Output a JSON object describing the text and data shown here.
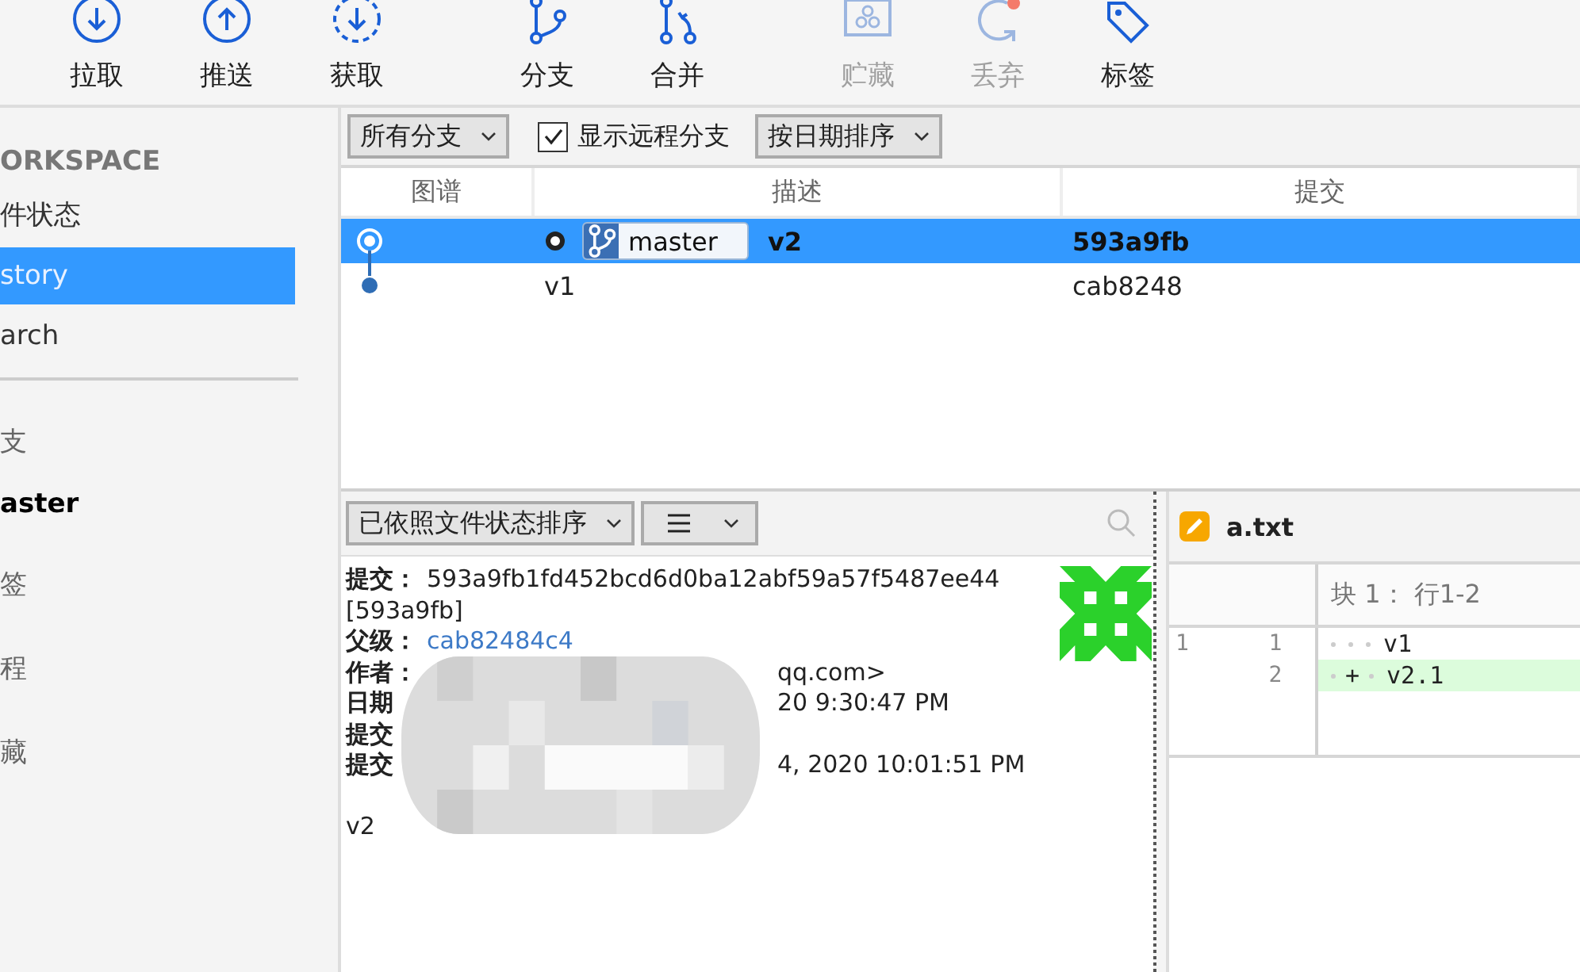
{
  "toolbar": [
    {
      "label": "拉取",
      "kind": "pull",
      "disabled": false
    },
    {
      "label": "推送",
      "kind": "push",
      "disabled": false
    },
    {
      "label": "获取",
      "kind": "fetch",
      "disabled": false
    },
    {
      "label": "分支",
      "kind": "branch",
      "disabled": false
    },
    {
      "label": "合并",
      "kind": "merge",
      "disabled": false
    },
    {
      "label": "贮藏",
      "kind": "stash",
      "disabled": true
    },
    {
      "label": "丢弃",
      "kind": "discard",
      "disabled": true
    },
    {
      "label": "标签",
      "kind": "tag",
      "disabled": false
    }
  ],
  "sidebar": {
    "workspace": {
      "title": "ORKSPACE",
      "items": [
        {
          "label": "件状态",
          "selected": false
        },
        {
          "label": "story",
          "selected": true
        },
        {
          "label": "arch",
          "selected": false
        }
      ]
    },
    "sections": [
      {
        "title": "支",
        "items": [
          {
            "label": "aster",
            "current": true
          }
        ]
      },
      {
        "title": "签"
      },
      {
        "title": "程"
      },
      {
        "title": "藏"
      }
    ]
  },
  "filters": {
    "branches": "所有分支",
    "remote": {
      "label": "显示远程分支",
      "checked": true
    },
    "sort": "按日期排序"
  },
  "table": {
    "columns": [
      "图谱",
      "描述",
      "提交"
    ],
    "rows": [
      {
        "selected": true,
        "branch": "master",
        "description": "v2",
        "commit": "593a9fb"
      },
      {
        "selected": false,
        "description": "v1",
        "commit": "cab8248"
      }
    ]
  },
  "details": {
    "sort": "已依照文件状态排序",
    "lines": [
      {
        "label": "提交：",
        "value": "593a9fb1fd452bcd6d0ba12abf59a57f5487ee44"
      },
      {
        "value": "[593a9fb]"
      },
      {
        "label": "父级：",
        "link": "cab82484c4"
      },
      {
        "label": "作者：",
        "tail": "qq.com>"
      },
      {
        "label": "日期",
        "tail": "20 9:30:47 PM"
      },
      {
        "label": "提交"
      },
      {
        "label": "提交",
        "tail": "4, 2020 10:01:51 PM"
      }
    ],
    "message": "v2"
  },
  "diff": {
    "file": "a.txt",
    "hunk": "块 1： 行1-2",
    "lines": [
      {
        "kind": "context",
        "old": "1",
        "new": "1",
        "text": "v1"
      },
      {
        "kind": "added",
        "new": "2",
        "sign": "+",
        "text": "v2.1"
      }
    ]
  }
}
